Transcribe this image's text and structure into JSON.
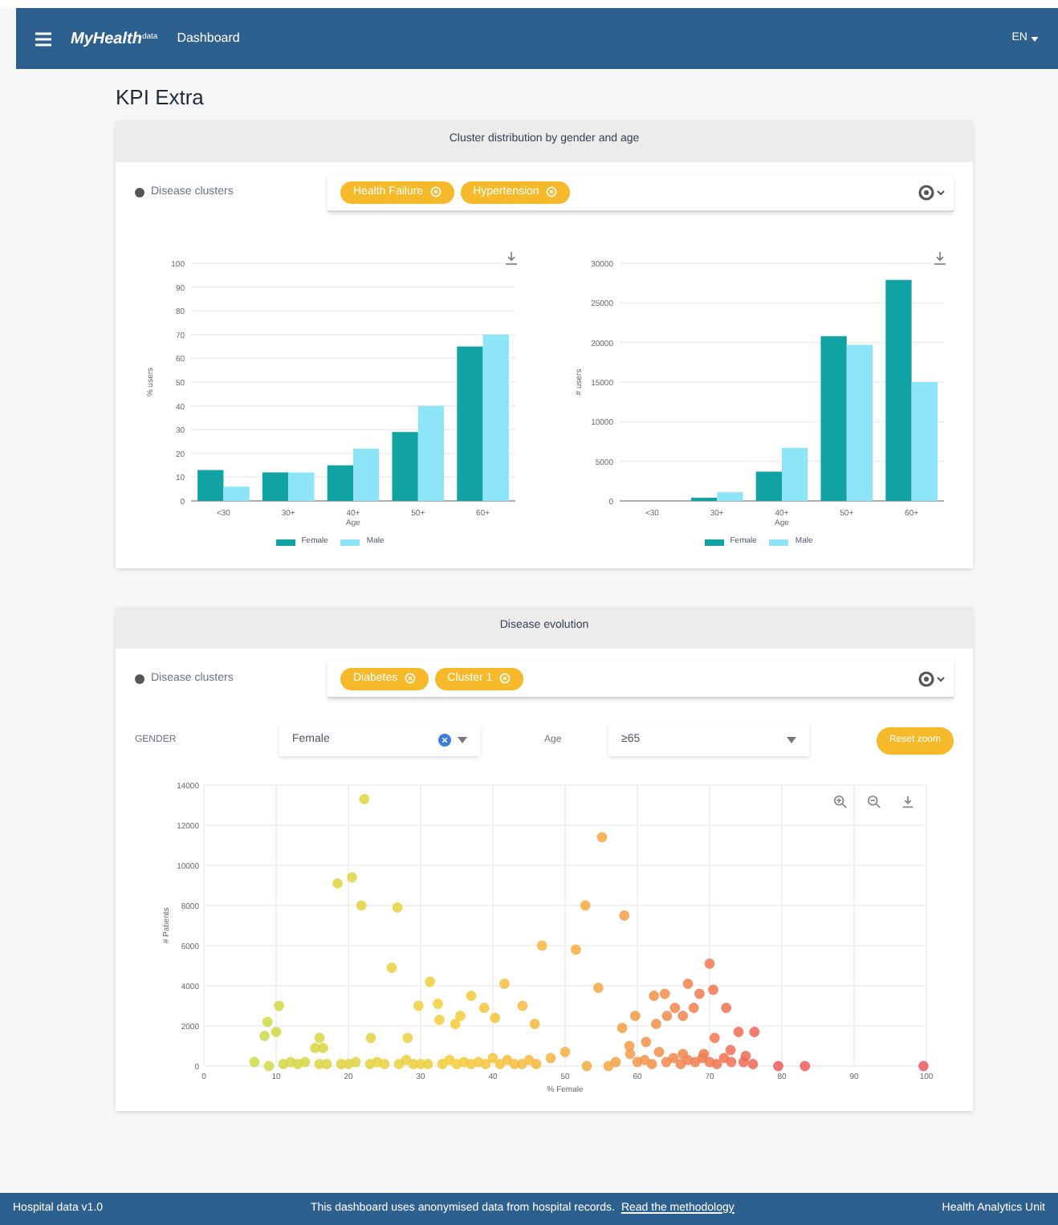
{
  "header": {
    "logo": "MyHealth",
    "logo_sup": "data",
    "title": "Dashboard",
    "language": "EN"
  },
  "page_title": "KPI Extra",
  "cluster_card": {
    "title": "Cluster distribution by gender and age",
    "filter_label": "Disease clusters",
    "chips": [
      "Health Failure",
      "Hypertension"
    ],
    "charts": [
      {
        "chart_data": {
          "type": "bar",
          "grid": true,
          "xlabel": "Age",
          "ylabel": "% users",
          "categories": [
            "<30",
            "30+",
            "40+",
            "50+",
            "60+"
          ],
          "ylim": [
            0,
            100
          ],
          "yticks": [
            0,
            10,
            20,
            30,
            40,
            50,
            60,
            70,
            80,
            90,
            100
          ],
          "series": [
            {
              "name": "Female",
              "color": "#11a3a3",
              "values": [
                13,
                12,
                15,
                29,
                65
              ]
            },
            {
              "name": "Male",
              "color": "#8ee5f8",
              "values": [
                6,
                12,
                22,
                40,
                70
              ]
            }
          ]
        }
      },
      {
        "chart_data": {
          "type": "bar",
          "grid": true,
          "xlabel": "Age",
          "ylabel": "# users",
          "categories": [
            "<30",
            "30+",
            "40+",
            "50+",
            "60+"
          ],
          "ylim": [
            0,
            30000
          ],
          "yticks": [
            0,
            5000,
            10000,
            15000,
            20000,
            25000,
            30000
          ],
          "series": [
            {
              "name": "Female",
              "color": "#11a3a3",
              "values": [
                0,
                400,
                3700,
                20800,
                27900
              ]
            },
            {
              "name": "Male",
              "color": "#8ee5f8",
              "values": [
                0,
                1100,
                6700,
                19700,
                15000
              ]
            }
          ]
        }
      }
    ]
  },
  "evolution_card": {
    "title": "Disease evolution",
    "filter_label": "Disease clusters",
    "chips": [
      "Diabetes",
      "Cluster 1"
    ],
    "gender_label": "GENDER",
    "gender_value": "Female",
    "age_label": "Age",
    "age_value": "≥65",
    "button": "Reset zoom",
    "chart_data": {
      "type": "scatter",
      "grid": true,
      "xlabel": "% Female",
      "ylabel": "# Patients",
      "xlim": [
        0,
        100
      ],
      "ylim": [
        0,
        14000
      ],
      "xticks": [
        0,
        10,
        20,
        30,
        40,
        50,
        60,
        70,
        80,
        90,
        100
      ],
      "yticks": [
        0,
        2000,
        4000,
        6000,
        8000,
        10000,
        12000,
        14000
      ],
      "x": [
        22.2,
        55.1,
        18.5,
        20.5,
        21.8,
        26.8,
        52.8,
        58.2,
        46.8,
        51.5,
        26,
        54.6,
        70,
        31.3,
        41.6,
        67,
        10.4,
        8.8,
        10,
        8.4,
        37,
        32.4,
        44.1,
        38.8,
        29.7,
        62.3,
        63.8,
        68.6,
        70.5,
        72.3,
        67.8,
        65.2,
        59.7,
        62.6,
        64.1,
        66.3,
        35.5,
        34.8,
        32.6,
        40.3,
        45.8,
        57.9,
        74,
        76.2,
        28.2,
        23.1,
        16,
        15.4,
        16.5,
        58.9,
        61.2,
        70.7,
        72.9,
        66.3,
        69.2,
        74.7,
        79.5,
        83.2,
        99.6,
        7,
        9,
        11,
        12,
        13,
        14,
        16,
        17,
        19,
        20,
        21,
        23,
        24,
        25,
        27,
        28,
        29,
        30,
        31,
        33,
        34,
        35,
        36,
        37,
        38,
        39,
        40,
        41,
        42,
        43,
        44,
        45,
        46,
        48,
        50,
        53,
        56,
        57,
        59,
        60,
        61,
        62,
        63,
        64,
        65,
        66,
        67,
        68,
        69,
        70,
        71,
        72,
        73,
        75,
        76
      ],
      "series": [
        {
          "values": [
            13300,
            11400,
            9100,
            9400,
            8000,
            7900,
            8000,
            7500,
            6000,
            5800,
            4900,
            3900,
            5100,
            4200,
            4100,
            4100,
            3000,
            2200,
            1700,
            1500,
            3500,
            3100,
            3000,
            2900,
            3000,
            3500,
            3600,
            3600,
            3800,
            2900,
            2900,
            2900,
            2500,
            2100,
            2500,
            2500,
            2500,
            2100,
            2300,
            2400,
            2100,
            1900,
            1700,
            1700,
            1400,
            1400,
            1400,
            900,
            900,
            1000,
            1200,
            1400,
            800,
            600,
            600,
            200,
            0,
            0,
            0,
            200,
            0,
            100,
            200,
            100,
            200,
            100,
            100,
            100,
            100,
            200,
            100,
            200,
            100,
            100,
            300,
            100,
            100,
            100,
            100,
            300,
            100,
            200,
            100,
            200,
            100,
            400,
            100,
            300,
            100,
            100,
            300,
            100,
            400,
            700,
            0,
            0,
            200,
            600,
            200,
            300,
            100,
            700,
            200,
            400,
            100,
            300,
            200,
            400,
            200,
            100,
            400,
            200,
            500,
            100
          ]
        }
      ]
    }
  },
  "footer": {
    "version": "Hospital data v1.0",
    "notice": "This dashboard uses anonymised data from hospital records.",
    "notice_link": "Read the methodology",
    "credit": "Health Analytics Unit"
  }
}
